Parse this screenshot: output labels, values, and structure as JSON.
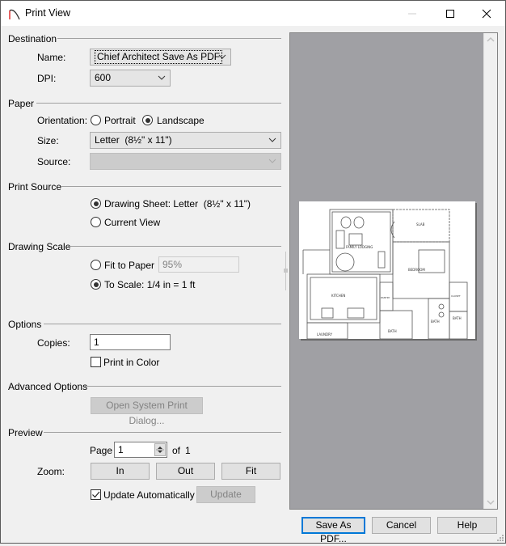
{
  "window": {
    "title": "Print View",
    "controls": {
      "minimize": "minimize-icon",
      "maximize": "maximize-icon",
      "close": "close-icon"
    }
  },
  "destination": {
    "section_label": "Destination",
    "name_label": "Name:",
    "name_value": "Chief Architect Save As PDF",
    "dpi_label": "DPI:",
    "dpi_value": "600"
  },
  "paper": {
    "section_label": "Paper",
    "orientation_label": "Orientation:",
    "orientation_options": [
      {
        "label": "Portrait",
        "checked": false
      },
      {
        "label": "Landscape",
        "checked": true
      }
    ],
    "size_label": "Size:",
    "size_value": "Letter  (8½\" x 11\")",
    "source_label": "Source:",
    "source_value": ""
  },
  "print_source": {
    "section_label": "Print Source",
    "options": [
      {
        "label": "Drawing Sheet: Letter  (8½\" x 11\")",
        "checked": true
      },
      {
        "label": "Current View",
        "checked": false
      }
    ]
  },
  "drawing_scale": {
    "section_label": "Drawing Scale",
    "fit_to_paper_label": "Fit to Paper",
    "fit_to_paper_checked": false,
    "fit_percent": "95%",
    "to_scale_label": "To Scale: 1/4 in = 1 ft",
    "to_scale_checked": true
  },
  "options": {
    "section_label": "Options",
    "copies_label": "Copies:",
    "copies_value": "1",
    "print_in_color_label": "Print in Color",
    "print_in_color_checked": false
  },
  "advanced_options": {
    "section_label": "Advanced Options",
    "open_dialog_label": "Open System Print Dialog..."
  },
  "preview": {
    "section_label": "Preview",
    "page_label": "Page",
    "page_value": "1",
    "of_label": "of",
    "page_total": "1",
    "zoom_label": "Zoom:",
    "zoom_in": "In",
    "zoom_out": "Out",
    "zoom_fit": "Fit",
    "update_auto_label": "Update Automatically",
    "update_auto_checked": true,
    "update_label": "Update",
    "room_labels": [
      "SLAB",
      "FAMILY LODGING",
      "BEDROOM",
      "KITCHEN",
      "PANTRY",
      "CLOSET",
      "BATH",
      "BATH",
      "BATH",
      "LAUNDRY"
    ]
  },
  "footer": {
    "save_pdf": "Save As PDF...",
    "cancel": "Cancel",
    "help": "Help"
  },
  "colors": {
    "accent": "#0078d7",
    "preview_bg": "#a0a0a4",
    "dialog_bg": "#f0f0f0"
  }
}
